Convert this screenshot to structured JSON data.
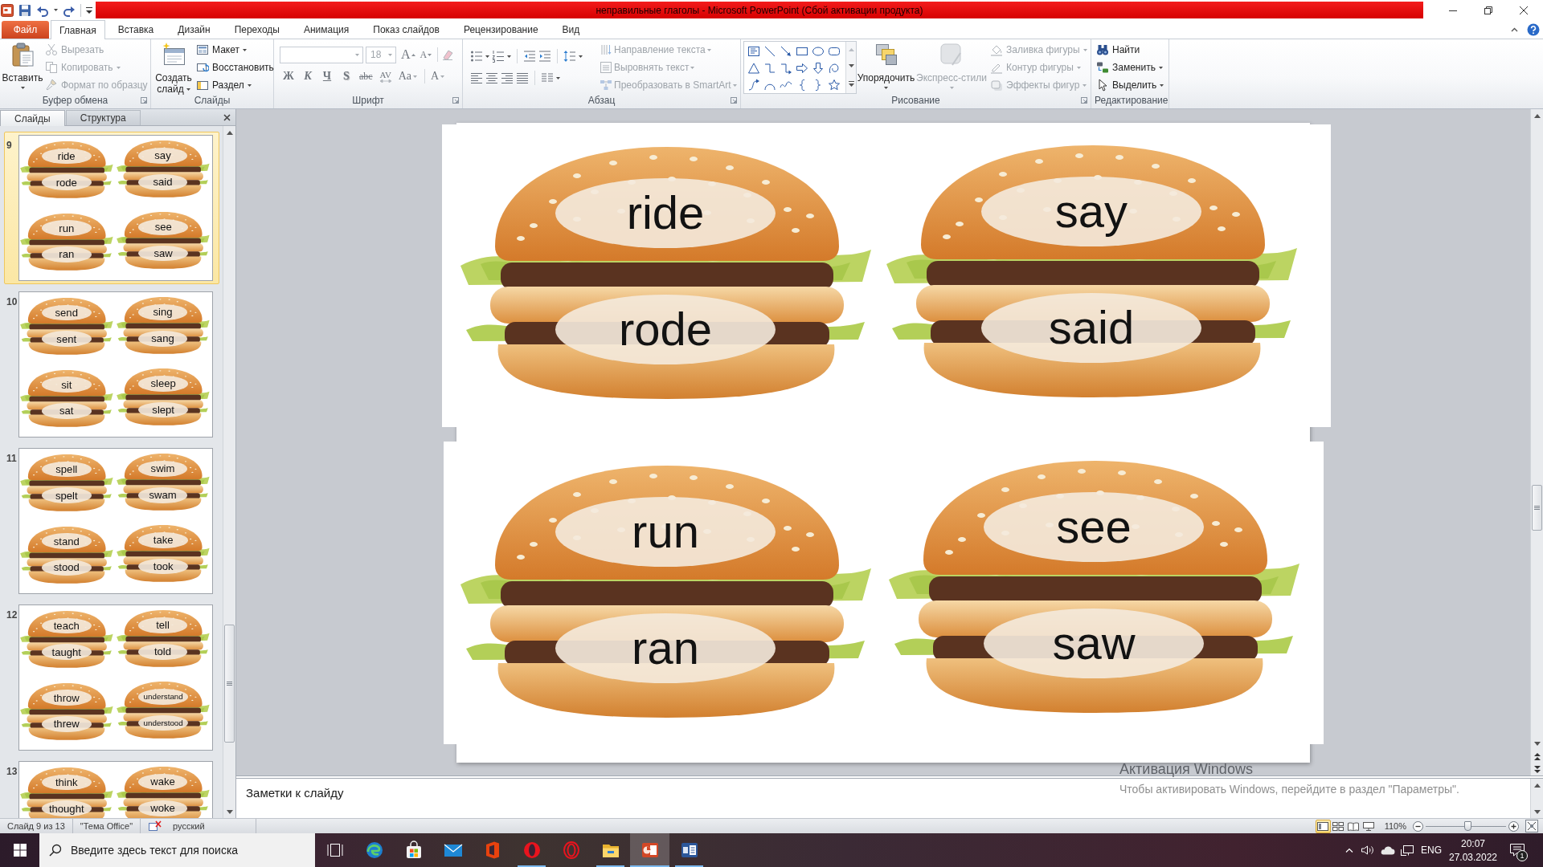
{
  "title_bar": {
    "title": "неправильные глаголы - Microsoft PowerPoint (Сбой активации продукта)"
  },
  "ribbon_tabs": [
    {
      "label": "Файл",
      "kind": "file_menu",
      "selected": false
    },
    {
      "label": "Главная",
      "kind": "tab",
      "selected": true
    },
    {
      "label": "Вставка",
      "kind": "tab",
      "selected": false
    },
    {
      "label": "Дизайн",
      "kind": "tab",
      "selected": false
    },
    {
      "label": "Переходы",
      "kind": "tab",
      "selected": false
    },
    {
      "label": "Анимация",
      "kind": "tab",
      "selected": false
    },
    {
      "label": "Показ слайдов",
      "kind": "tab",
      "selected": false
    },
    {
      "label": "Рецензирование",
      "kind": "tab",
      "selected": false
    },
    {
      "label": "Вид",
      "kind": "tab",
      "selected": false
    }
  ],
  "clipboard": {
    "title": "Буфер обмена",
    "paste": {
      "label": "Вставить",
      "disabled": false
    },
    "cut": {
      "label": "Вырезать",
      "disabled": true
    },
    "copy": {
      "label": "Копировать",
      "disabled": true
    },
    "format_painter": {
      "label": "Формат по образцу",
      "disabled": true
    }
  },
  "slides_group": {
    "title": "Слайды",
    "new_slide": {
      "label": "Создать слайд",
      "disabled": false
    },
    "layout": {
      "label": "Макет",
      "disabled": false
    },
    "reset": {
      "label": "Восстановить",
      "disabled": false
    },
    "section": {
      "label": "Раздел",
      "disabled": false
    }
  },
  "font": {
    "title": "Шрифт",
    "disabled": true,
    "font_size": {
      "value": "18"
    },
    "grow": {
      "label": "A"
    },
    "shrink": {
      "label": "A"
    },
    "styles": [
      {
        "label": "Ж",
        "kind": "bold"
      },
      {
        "label": "К",
        "kind": "italic"
      },
      {
        "label": "Ч",
        "kind": "underline"
      },
      {
        "label": "S",
        "kind": "shadow"
      },
      {
        "label": "abc",
        "kind": "strikethrough"
      },
      {
        "label": "AV",
        "kind": "spacing"
      },
      {
        "label": "Aa",
        "kind": "case"
      }
    ],
    "color": {
      "label": "A"
    }
  },
  "paragraph": {
    "title": "Абзац",
    "text_direction": {
      "label": "Направление текста",
      "disabled": true
    },
    "align_text": {
      "label": "Выровнять текст",
      "disabled": true
    },
    "smartart": {
      "label": "Преобразовать в SmartArt",
      "disabled": true
    }
  },
  "drawing": {
    "title": "Рисование",
    "arrange": {
      "label": "Упорядочить",
      "disabled": false
    },
    "quick_styles": {
      "label": "Экспресс-стили",
      "disabled": true
    },
    "fill": {
      "label": "Заливка фигуры",
      "disabled": true
    },
    "outline": {
      "label": "Контур фигуры",
      "disabled": true
    },
    "effects": {
      "label": "Эффекты фигур",
      "disabled": true
    }
  },
  "editing": {
    "title": "Редактирование",
    "find": {
      "label": "Найти",
      "disabled": false
    },
    "replace": {
      "label": "Заменить",
      "disabled": false
    },
    "select": {
      "label": "Выделить",
      "disabled": false
    }
  },
  "slides_pane": {
    "tabs": [
      {
        "label": "Слайды",
        "selected": true
      },
      {
        "label": "Структура",
        "selected": false
      }
    ],
    "thumbnails": [
      {
        "number": "9",
        "selected": true,
        "burgers": [
          {
            "top": "ride",
            "bottom": "rode"
          },
          {
            "top": "say",
            "bottom": "said"
          },
          {
            "top": "run",
            "bottom": "ran"
          },
          {
            "top": "see",
            "bottom": "saw"
          }
        ]
      },
      {
        "number": "10",
        "selected": false,
        "burgers": [
          {
            "top": "send",
            "bottom": "sent"
          },
          {
            "top": "sing",
            "bottom": "sang"
          },
          {
            "top": "sit",
            "bottom": "sat"
          },
          {
            "top": "sleep",
            "bottom": "slept"
          }
        ]
      },
      {
        "number": "11",
        "selected": false,
        "burgers": [
          {
            "top": "spell",
            "bottom": "spelt"
          },
          {
            "top": "swim",
            "bottom": "swam"
          },
          {
            "top": "stand",
            "bottom": "stood"
          },
          {
            "top": "take",
            "bottom": "took"
          }
        ]
      },
      {
        "number": "12",
        "selected": false,
        "burgers": [
          {
            "top": "teach",
            "bottom": "taught"
          },
          {
            "top": "tell",
            "bottom": "told"
          },
          {
            "top": "throw",
            "bottom": "threw"
          },
          {
            "top": "understand",
            "bottom": "understood"
          }
        ]
      },
      {
        "number": "13",
        "selected": false,
        "burgers": [
          {
            "top": "think",
            "bottom": "thought"
          },
          {
            "top": "wake",
            "bottom": "woke"
          }
        ]
      }
    ]
  },
  "slide": {
    "burgers": [
      {
        "top": "ride",
        "bottom": "rode"
      },
      {
        "top": "say",
        "bottom": "said"
      },
      {
        "top": "run",
        "bottom": "ran"
      },
      {
        "top": "see",
        "bottom": "saw"
      }
    ]
  },
  "notes": {
    "placeholder": "Заметки к слайду"
  },
  "activation": {
    "title": "Активация Windows",
    "message": "Чтобы активировать Windows, перейдите в раздел \"Параметры\"."
  },
  "status_bar": {
    "slide_position": "Слайд 9 из 13",
    "theme": "\"Тема Office\"",
    "language": "русский",
    "views": [
      {
        "kind": "normal",
        "selected": true
      },
      {
        "kind": "sorter",
        "selected": false
      },
      {
        "kind": "reading",
        "selected": false
      },
      {
        "kind": "slideshow",
        "selected": false
      }
    ],
    "zoom": {
      "label": "110%",
      "level": 0.52
    }
  },
  "taskbar": {
    "search": {
      "placeholder": "Введите здесь текст для поиска"
    },
    "apps": [
      {
        "kind": "task_view",
        "running": false,
        "active": false
      },
      {
        "kind": "browser",
        "running": false,
        "active": false
      },
      {
        "kind": "store",
        "running": false,
        "active": false
      },
      {
        "kind": "mail",
        "running": false,
        "active": false
      },
      {
        "kind": "logo_tile",
        "running": false,
        "active": false
      },
      {
        "kind": "ring",
        "running": true,
        "active": false
      },
      {
        "kind": "ring_outline",
        "running": false,
        "active": false
      },
      {
        "kind": "folder",
        "running": true,
        "active": false
      },
      {
        "kind": "presentation",
        "running": true,
        "active": true
      },
      {
        "kind": "document",
        "running": true,
        "active": false
      }
    ],
    "tray": {
      "language": "ENG",
      "time": "20:07",
      "date": "27.03.2022",
      "notifications": "1"
    }
  }
}
